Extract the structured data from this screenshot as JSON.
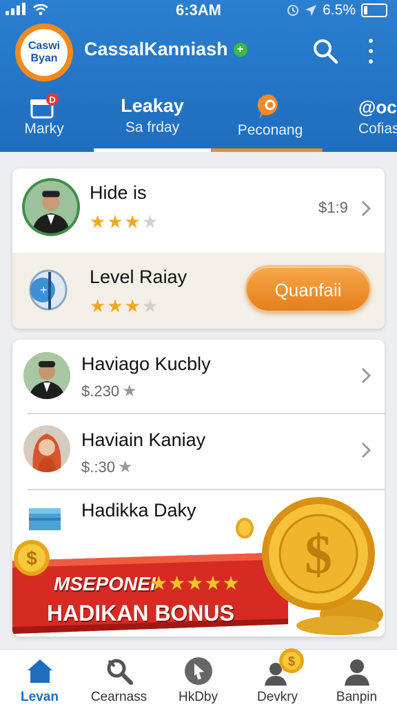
{
  "status_bar": {
    "time": "6:3AM",
    "battery_text": "6.5%",
    "battery_level": 0.15
  },
  "app": {
    "logo_line1": "Caswi",
    "logo_line2": "Byan",
    "title": "CassalKanniash",
    "title_badge": "+",
    "colors": {
      "header": "#1f6dbf",
      "accent": "#f28a1e",
      "nav_active": "#1f6dbf"
    }
  },
  "tabs": [
    {
      "icon": "gift-icon",
      "label": "Marky",
      "badge": "D"
    },
    {
      "title": "Leakay",
      "label": "Sa frday"
    },
    {
      "icon": "chat-bubble-icon",
      "label": "Peconang"
    },
    {
      "icon": "coins-icon",
      "label": "Cofias",
      "partial_title": "@oc"
    }
  ],
  "featured": {
    "user": {
      "name": "Hide is",
      "price": "$1:9",
      "rating": 3,
      "max": 4,
      "icon": "avatar-man"
    },
    "level": {
      "name": "Level Raiay",
      "rating": 3,
      "max": 4,
      "button": "Quanfaii",
      "icon": "magnifier-plus-icon"
    }
  },
  "list": [
    {
      "name": "Haviago Kucbly",
      "price": "$.230",
      "icon": "avatar-man"
    },
    {
      "name": "Haviain Kaniay",
      "price": "$.:30",
      "icon": "avatar-woman"
    },
    {
      "name": "Hadikka Daky",
      "icon": "box-icon"
    }
  ],
  "banner": {
    "line1": "MSEPONEI",
    "line2": "HADIKAN BONUS",
    "stars": 5,
    "icon": "dollar-coin-icon"
  },
  "bottom_nav": [
    {
      "label": "Levan",
      "icon": "home-icon",
      "active": true
    },
    {
      "label": "Cearnass",
      "icon": "search-tool-icon",
      "active": false
    },
    {
      "label": "HkDby",
      "icon": "cursor-icon",
      "active": false
    },
    {
      "label": "Devkry",
      "icon": "user-coin-icon",
      "active": false
    },
    {
      "label": "Banpin",
      "icon": "user-icon",
      "active": false
    }
  ]
}
